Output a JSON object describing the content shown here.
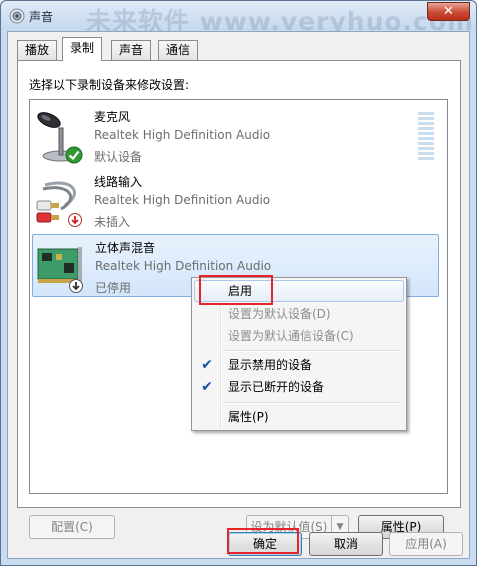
{
  "window": {
    "title": "声音",
    "watermark": "未来软件 www.veryhuo.com",
    "close_label": "✕"
  },
  "tabs": [
    {
      "label": "播放",
      "active": false
    },
    {
      "label": "录制",
      "active": true
    },
    {
      "label": "声音",
      "active": false
    },
    {
      "label": "通信",
      "active": false
    }
  ],
  "panel": {
    "prompt": "选择以下录制设备来修改设置:"
  },
  "devices": [
    {
      "name": "麦克风",
      "driver": "Realtek High Definition Audio",
      "status": "默认设备",
      "icon": "microphone-icon",
      "badge": "default-check-icon"
    },
    {
      "name": "线路输入",
      "driver": "Realtek High Definition Audio",
      "status": "未插入",
      "icon": "line-in-jack-icon",
      "badge": "unplugged-down-arrow-icon"
    },
    {
      "name": "立体声混音",
      "driver": "Realtek High Definition Audio",
      "status": "已停用",
      "icon": "sound-card-icon",
      "badge": "disabled-down-arrow-icon"
    }
  ],
  "context_menu": {
    "items": [
      {
        "label": "启用",
        "disabled": false,
        "checked": false,
        "hot": true
      },
      {
        "label": "设置为默认设备(D)",
        "disabled": true,
        "checked": false
      },
      {
        "label": "设置为默认通信设备(C)",
        "disabled": true,
        "checked": false
      },
      {
        "label": "显示禁用的设备",
        "disabled": false,
        "checked": true
      },
      {
        "label": "显示已断开的设备",
        "disabled": false,
        "checked": true
      },
      {
        "label": "属性(P)",
        "disabled": false,
        "checked": false
      }
    ]
  },
  "panel_buttons": {
    "configure": "配置(C)",
    "set_default": "设为默认值(S)",
    "dropdown_arrow": "▼",
    "properties": "属性(P)"
  },
  "dialog_buttons": {
    "ok": "确定",
    "cancel": "取消",
    "apply": "应用(A)"
  },
  "colors": {
    "selection_border": "#84acdd",
    "highlight_box": "#e8232a",
    "check": "#1b4fa8"
  }
}
